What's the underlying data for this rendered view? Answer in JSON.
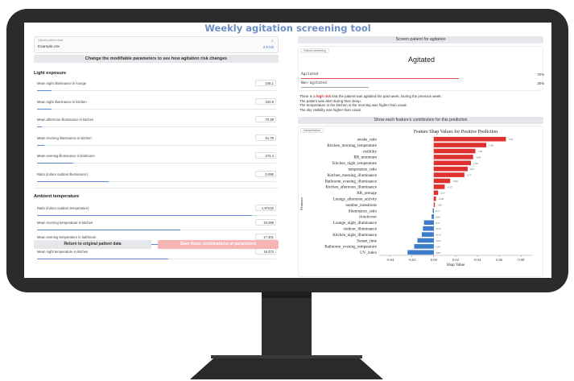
{
  "app": {
    "title": "Weekly agitation screening tool"
  },
  "upload": {
    "caption": "Upload patient data",
    "filename": "Example.csv",
    "filesize": "2.5 KB",
    "close_icon": "close-icon"
  },
  "modify_button": "Change the modifiable parameters to see how agitation risk changes",
  "light": {
    "heading": "Light exposure",
    "sliders": [
      {
        "label": "Mean night illuminance in lounge",
        "value": "245.1",
        "fraction": 0.06
      },
      {
        "label": "Mean night illuminance in kitchen",
        "value": "222.9",
        "fraction": 0.06
      },
      {
        "label": "Mean afternoon illuminance in kitchen",
        "value": "70.39",
        "fraction": 0.02
      },
      {
        "label": "Mean morning illuminance in kitchen",
        "value": "81.78",
        "fraction": 0.03
      },
      {
        "label": "Mean evening illuminance in bathroom",
        "value": "274.4",
        "fraction": 0.15
      },
      {
        "label": "Ratio (indoor outdoor illuminance)",
        "value": "0.090",
        "fraction": 0.3
      }
    ]
  },
  "temp": {
    "heading": "Ambient temperature",
    "sliders": [
      {
        "label": "Ratio (indoor outdoor temperature)",
        "value": "1.97232",
        "fraction": 0.9
      },
      {
        "label": "Mean morning temperature in kitchen",
        "value": "19.289",
        "fraction": 0.6
      },
      {
        "label": "Mean evening temperature in bathroom",
        "value": "17.301",
        "fraction": 0.55
      },
      {
        "label": "Mean night temperature in kitchen",
        "value": "19.372",
        "fraction": 0.55
      }
    ]
  },
  "buttons": {
    "return": "Return to original patient data",
    "save": "Save these combinations of parameters"
  },
  "screen": {
    "header": "Screen patient for agitation",
    "tab": "Patient screening",
    "result": "Agitated",
    "rows": [
      {
        "name": "Agitated",
        "pct": "70%",
        "fraction": 0.7,
        "color": "#e74c4c"
      },
      {
        "name": "Non-agitated",
        "pct": "30%",
        "fraction": 0.3,
        "color": "#9aa4b2"
      }
    ],
    "narrative_pre": "There is a ",
    "narrative_hl": "high risk",
    "narrative_post": " that the patient was agitated the past week. During the previous week:",
    "lines": [
      "The patient was alert during their sleep.",
      "The temperature in the kitchen in the morning was higher than usual.",
      "The sky visibility was higher than usual."
    ]
  },
  "contrib": {
    "header": "Show each feature's contribution for this prediction",
    "tab": "Interpretation"
  },
  "chart_data": {
    "type": "bar",
    "orientation": "horizontal",
    "title": "Feature Shap Values for Positive Prediction",
    "xlabel": "Shap Value",
    "ylabel": "Features",
    "xlim": [
      -0.05,
      0.09
    ],
    "xticks": [
      "-0.04",
      "-0.02",
      "0.00",
      "0.02",
      "0.04",
      "0.06",
      "0.08"
    ],
    "xtick_values": [
      -0.04,
      -0.02,
      0.0,
      0.02,
      0.04,
      0.06,
      0.08
    ],
    "positive_color": "#e03131",
    "negative_color": "#3d7cc9",
    "categories": [
      "awake_ratio",
      "Kitchen_morning_temperature",
      "visibility",
      "RR_minimum",
      "Kitchen_night_temperature",
      "temperature_ratio",
      "Kitchen_morning_illuminance",
      "Bathroom_evening_illuminance",
      "Kitchen_afternoon_illuminance",
      "RR_average",
      "Lounge_afternoon_activity",
      "number_transitions",
      "illuminance_ratio",
      "cloudcover",
      "Lounge_night_illuminance",
      "outdoor_illuminance",
      "Kitchen_night_illuminance",
      "Sunset_time",
      "Bathroom_evening_temperature",
      "UV_index"
    ],
    "values": [
      0.066,
      0.048,
      0.038,
      0.036,
      0.034,
      0.031,
      0.028,
      0.015,
      0.01,
      0.004,
      0.002,
      0.001,
      -0.001,
      -0.002,
      -0.009,
      -0.01,
      -0.011,
      -0.015,
      -0.018,
      -0.024
    ],
    "labels": [
      "1.84",
      "1.40",
      "1.26",
      "-0.64",
      "1.36",
      "0.67",
      "0.77",
      "-0.66",
      "-0.27",
      "0.77",
      "-0.80",
      "1.60",
      "0.17",
      "0.60",
      "0.17",
      "-0.70",
      "-0.10",
      "-0.62",
      "1.64",
      "-0.87"
    ]
  }
}
